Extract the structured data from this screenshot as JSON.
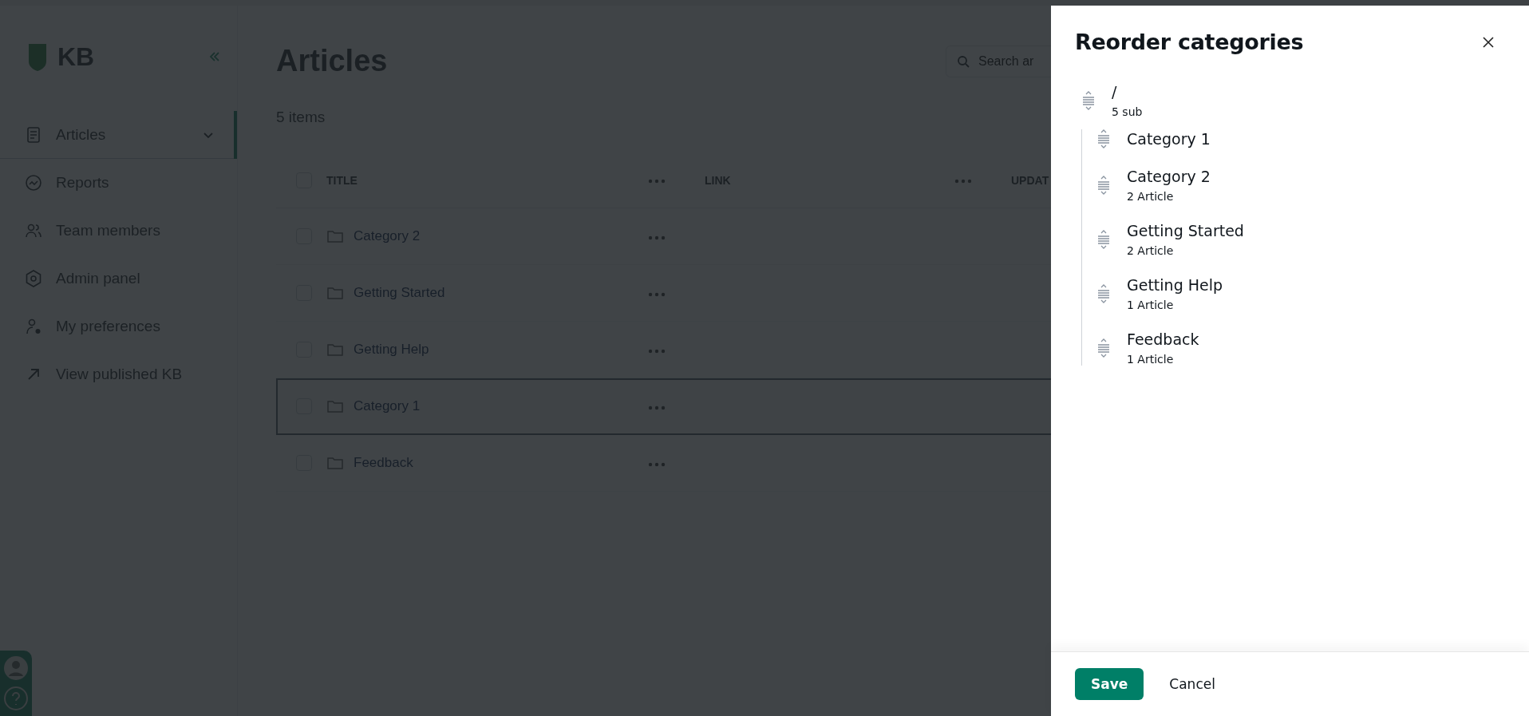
{
  "background": {
    "logo": {
      "text": "KB"
    },
    "sidebar": {
      "items": [
        {
          "label": "Articles",
          "selected": true,
          "expanded": true
        },
        {
          "label": "Reports",
          "selected": false
        },
        {
          "label": "Team members",
          "selected": false
        },
        {
          "label": "Admin panel",
          "selected": false
        },
        {
          "label": "My preferences",
          "selected": false
        },
        {
          "label": "View published KB",
          "selected": false
        }
      ]
    },
    "page": {
      "title": "Articles",
      "search": {
        "placeholder": "Search ar"
      },
      "count": "5 items",
      "table": {
        "columns": [
          "TITLE",
          "LINK",
          "UPDAT"
        ],
        "all_checked": false,
        "rows": [
          {
            "title": "Category 2",
            "checked": false,
            "selected": false
          },
          {
            "title": "Getting Started",
            "checked": false,
            "selected": false
          },
          {
            "title": "Getting Help",
            "checked": false,
            "selected": false
          },
          {
            "title": "Category 1",
            "checked": false,
            "selected": true
          },
          {
            "title": "Feedback",
            "checked": false,
            "selected": false
          }
        ]
      }
    }
  },
  "drawer": {
    "title": "Reorder categories",
    "tree": {
      "label": "/",
      "meta": "5 sub",
      "children": [
        {
          "label": "Category 1"
        },
        {
          "label": "Category 2",
          "meta": "2 Article"
        },
        {
          "label": "Getting Started",
          "meta": "2 Article"
        },
        {
          "label": "Getting Help",
          "meta": "1 Article"
        },
        {
          "label": "Feedback",
          "meta": "1 Article"
        }
      ]
    },
    "buttons": [
      {
        "label": "Save",
        "kind": "primary"
      },
      {
        "label": "Cancel",
        "kind": "text"
      }
    ]
  }
}
